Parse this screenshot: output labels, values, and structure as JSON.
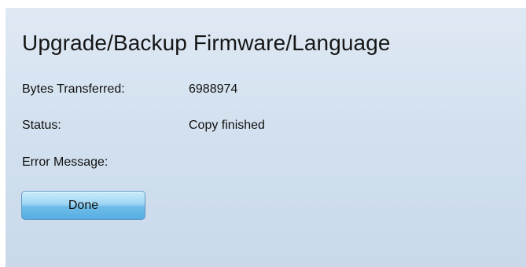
{
  "page": {
    "title": "Upgrade/Backup Firmware/Language"
  },
  "fields": {
    "bytes_transferred": {
      "label": "Bytes Transferred:",
      "value": "6988974"
    },
    "status": {
      "label": "Status:",
      "value": "Copy finished"
    },
    "error_message": {
      "label": "Error Message:",
      "value": ""
    }
  },
  "actions": {
    "done_label": "Done"
  }
}
